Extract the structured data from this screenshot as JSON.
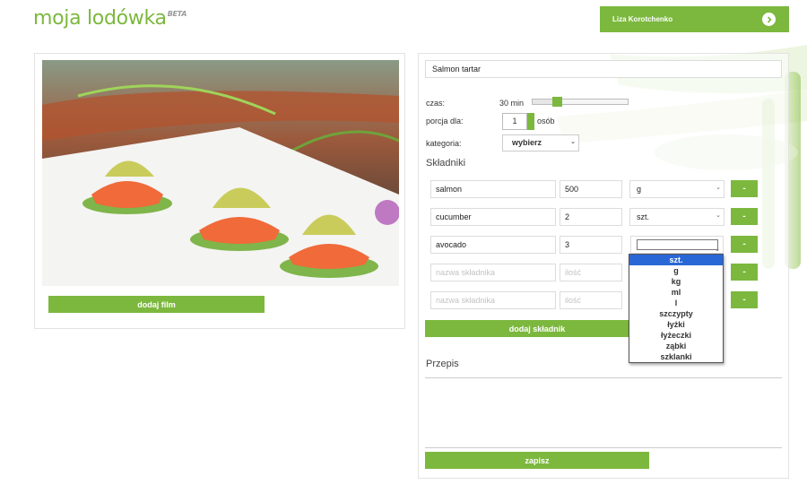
{
  "header": {
    "logo": "moja lodówka",
    "logo_badge": "BETA",
    "user_name": "Liza Korotchenko",
    "brand_color": "#7cb83e"
  },
  "left": {
    "add_film_label": "dodaj film"
  },
  "recipe": {
    "title_value": "Salmon tartar",
    "time_label": "czas:",
    "time_value": "30 min",
    "time_slider_fraction": 0.21,
    "portion_label": "porcja dla:",
    "portion_value": "1",
    "portion_unit": "osób",
    "category_label": "kategoria:",
    "category_value": "wybierz",
    "ingredients_title": "Składniki",
    "ingredients": [
      {
        "name": "salmon",
        "qty": "500",
        "unit": "g",
        "remove": "-"
      },
      {
        "name": "cucumber",
        "qty": "2",
        "unit": "szt.",
        "remove": "-"
      },
      {
        "name": "avocado",
        "qty": "3",
        "unit": "",
        "remove": "-"
      },
      {
        "name_placeholder": "nazwa składnika",
        "qty_placeholder": "ilość",
        "remove": "-"
      },
      {
        "name_placeholder": "nazwa składnika",
        "qty_placeholder": "ilość",
        "remove": "-"
      }
    ],
    "add_ingredient_label": "dodaj składnik",
    "recipe_title": "Przepis",
    "save_label": "zapisz"
  },
  "unit_dropdown": {
    "options": [
      "szt.",
      "g",
      "kg",
      "ml",
      "l",
      "szczypty",
      "łyżki",
      "łyżeczki",
      "ząbki",
      "szklanki"
    ],
    "selected": "szt.",
    "highlight_color": "#2a67d6"
  }
}
